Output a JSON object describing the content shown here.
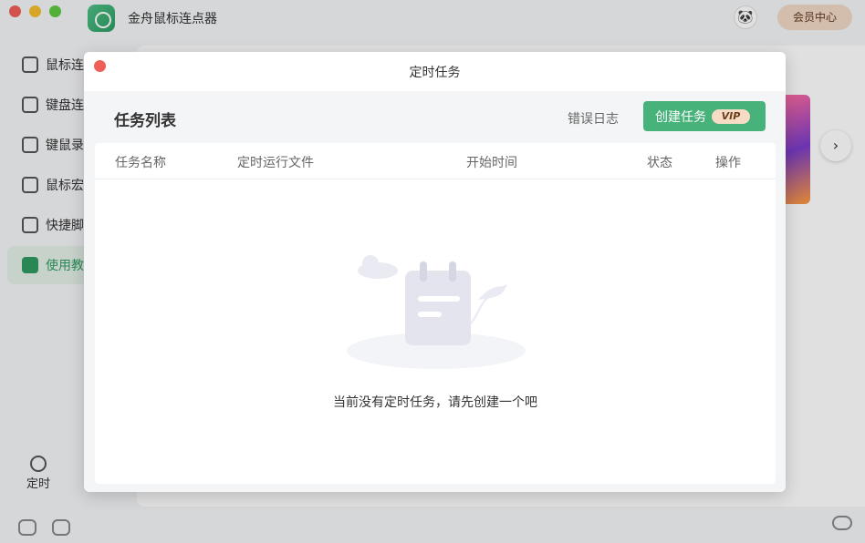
{
  "app": {
    "title": "金舟鼠标连点器",
    "member_button": "会员中心"
  },
  "sidebar": {
    "items": [
      {
        "label": "鼠标连"
      },
      {
        "label": "键盘连"
      },
      {
        "label": "键鼠录"
      },
      {
        "label": "鼠标宏"
      },
      {
        "label": "快捷脚"
      },
      {
        "label": "使用教"
      }
    ],
    "bottom_label": "定时"
  },
  "modal": {
    "title": "定时任务",
    "list_title": "任务列表",
    "error_log": "错误日志",
    "create_button": "创建任务",
    "vip_badge": "VIP",
    "columns": [
      "任务名称",
      "定时运行文件",
      "开始时间",
      "状态",
      "操作"
    ],
    "empty_message": "当前没有定时任务，请先创建一个吧"
  },
  "colors": {
    "accent": "#48b27b",
    "close": "#ee5f57"
  }
}
